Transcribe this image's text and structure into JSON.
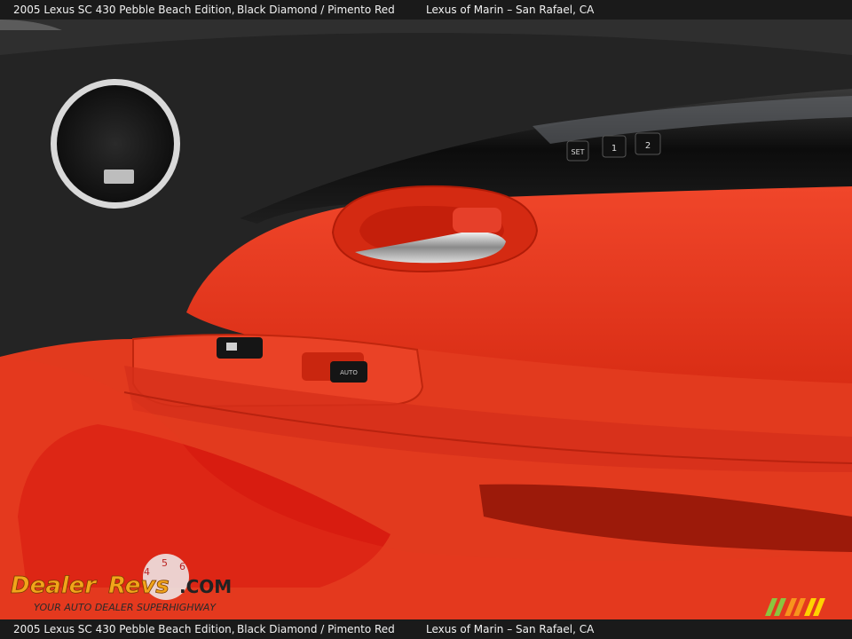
{
  "caption": {
    "vehicle": "2005 Lexus SC 430 Pebble Beach Edition,",
    "colors": "Black Diamond / Pimento Red",
    "dealer": "Lexus of Marin – San Rafael, CA"
  },
  "photo": {
    "subject": "car-door-interior",
    "colors": {
      "leather": "#e8391f",
      "leather_dark": "#b8220f",
      "black_trim": "#1a1a1a",
      "chrome": "#c9c9c9"
    },
    "memory_buttons": [
      "SET",
      "1",
      "2"
    ],
    "switch_labels": [
      "AUTO"
    ]
  },
  "watermark": {
    "brand_left": "Dealer",
    "brand_right": "Revs",
    "domain": ".COM",
    "tagline": "YOUR AUTO DEALER SUPERHIGHWAY",
    "dial_digits": [
      "4",
      "5",
      "6"
    ]
  }
}
